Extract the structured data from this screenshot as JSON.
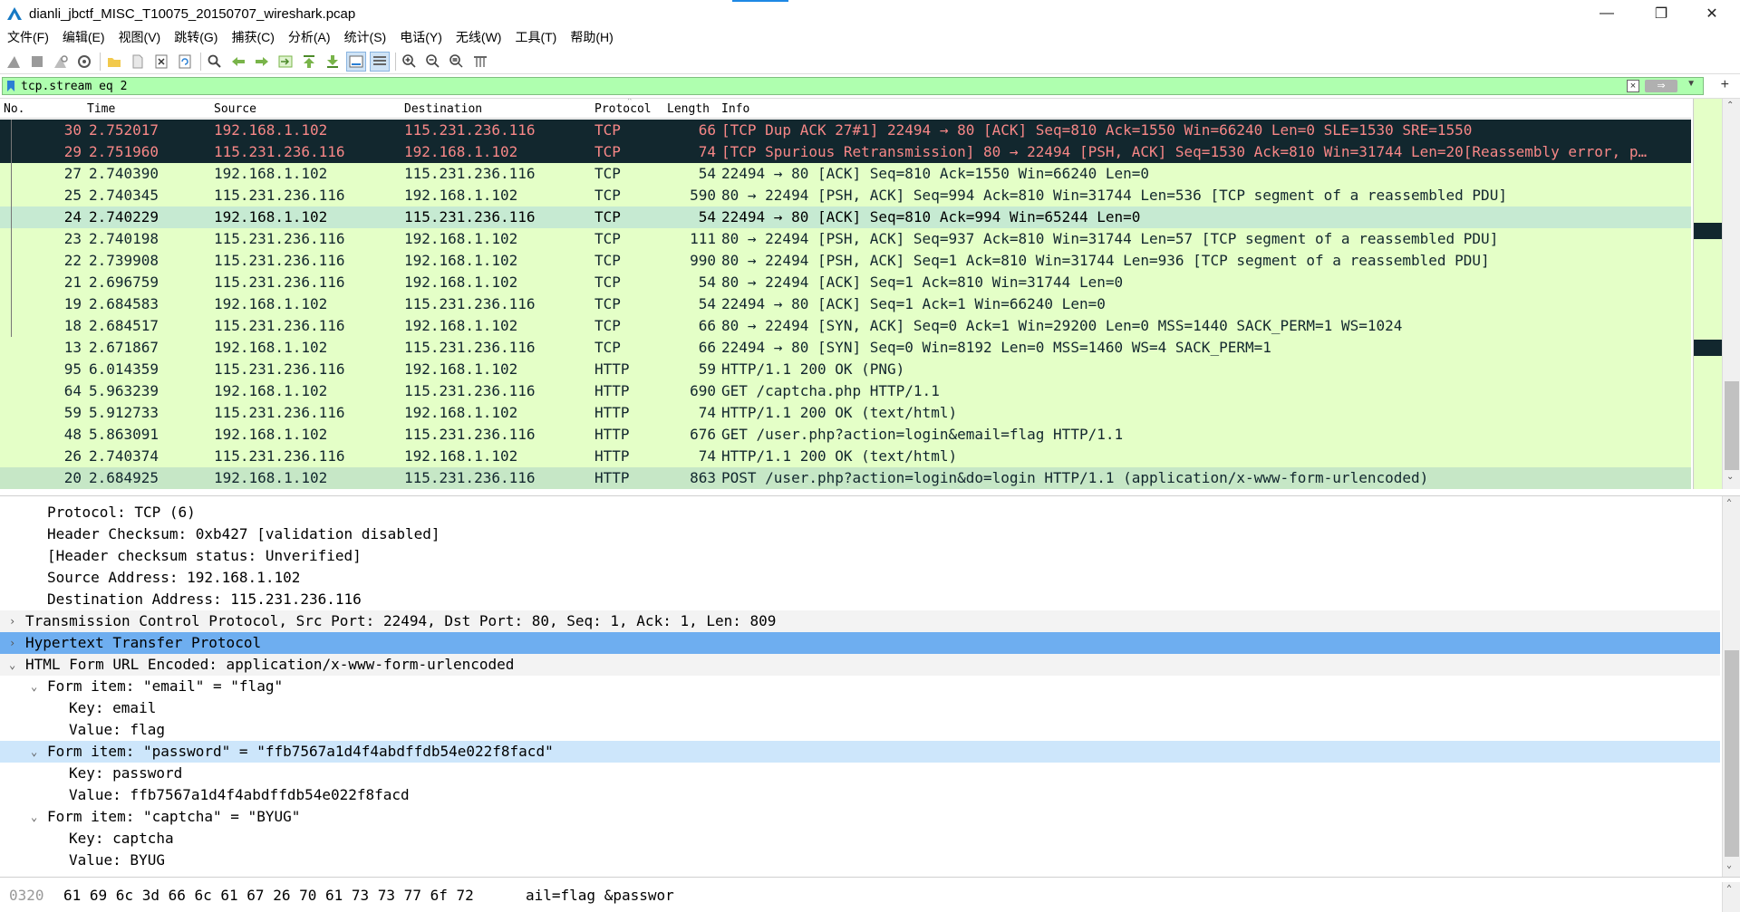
{
  "window": {
    "title": "dianli_jbctf_MISC_T10075_20150707_wireshark.pcap",
    "minimize": "—",
    "maximize": "❐",
    "close": "✕"
  },
  "menu": [
    "文件(F)",
    "编辑(E)",
    "视图(V)",
    "跳转(G)",
    "捕获(C)",
    "分析(A)",
    "统计(S)",
    "电话(Y)",
    "无线(W)",
    "工具(T)",
    "帮助(H)"
  ],
  "filter": {
    "value": "tcp.stream eq 2",
    "clear": "×",
    "apply": "⇒",
    "dropdown": "▼",
    "add": "+"
  },
  "packet_list": {
    "columns": [
      "No.",
      "Time",
      "Source",
      "Destination",
      "Protocol",
      "Length",
      "Info"
    ],
    "rows": [
      {
        "no": "30",
        "time": "2.752017",
        "src": "192.168.1.102",
        "dst": "115.231.236.116",
        "proto": "TCP",
        "len": "66",
        "info": "[TCP Dup ACK 27#1] 22494 → 80 [ACK] Seq=810 Ack=1550 Win=66240 Len=0 SLE=1530 SRE=1550",
        "style": "black"
      },
      {
        "no": "29",
        "time": "2.751960",
        "src": "115.231.236.116",
        "dst": "192.168.1.102",
        "proto": "TCP",
        "len": "74",
        "info": "[TCP Spurious Retransmission] 80 → 22494 [PSH, ACK] Seq=1530 Ack=810 Win=31744 Len=20[Reassembly error, p…",
        "style": "black"
      },
      {
        "no": "27",
        "time": "2.740390",
        "src": "192.168.1.102",
        "dst": "115.231.236.116",
        "proto": "TCP",
        "len": "54",
        "info": "22494 → 80 [ACK] Seq=810 Ack=1550 Win=66240 Len=0",
        "style": "green"
      },
      {
        "no": "25",
        "time": "2.740345",
        "src": "115.231.236.116",
        "dst": "192.168.1.102",
        "proto": "TCP",
        "len": "590",
        "info": "80 → 22494 [PSH, ACK] Seq=994 Ack=810 Win=31744 Len=536 [TCP segment of a reassembled PDU]",
        "style": "green"
      },
      {
        "no": "24",
        "time": "2.740229",
        "src": "192.168.1.102",
        "dst": "115.231.236.116",
        "proto": "TCP",
        "len": "54",
        "info": "22494 → 80 [ACK] Seq=810 Ack=994 Win=65244 Len=0",
        "style": "tint"
      },
      {
        "no": "23",
        "time": "2.740198",
        "src": "115.231.236.116",
        "dst": "192.168.1.102",
        "proto": "TCP",
        "len": "111",
        "info": "80 → 22494 [PSH, ACK] Seq=937 Ack=810 Win=31744 Len=57 [TCP segment of a reassembled PDU]",
        "style": "green"
      },
      {
        "no": "22",
        "time": "2.739908",
        "src": "115.231.236.116",
        "dst": "192.168.1.102",
        "proto": "TCP",
        "len": "990",
        "info": "80 → 22494 [PSH, ACK] Seq=1 Ack=810 Win=31744 Len=936 [TCP segment of a reassembled PDU]",
        "style": "green"
      },
      {
        "no": "21",
        "time": "2.696759",
        "src": "115.231.236.116",
        "dst": "192.168.1.102",
        "proto": "TCP",
        "len": "54",
        "info": "80 → 22494 [ACK] Seq=1 Ack=810 Win=31744 Len=0",
        "style": "green"
      },
      {
        "no": "19",
        "time": "2.684583",
        "src": "192.168.1.102",
        "dst": "115.231.236.116",
        "proto": "TCP",
        "len": "54",
        "info": "22494 → 80 [ACK] Seq=1 Ack=1 Win=66240 Len=0",
        "style": "green"
      },
      {
        "no": "18",
        "time": "2.684517",
        "src": "115.231.236.116",
        "dst": "192.168.1.102",
        "proto": "TCP",
        "len": "66",
        "info": "80 → 22494 [SYN, ACK] Seq=0 Ack=1 Win=29200 Len=0 MSS=1440 SACK_PERM=1 WS=1024",
        "style": "green"
      },
      {
        "no": "13",
        "time": "2.671867",
        "src": "192.168.1.102",
        "dst": "115.231.236.116",
        "proto": "TCP",
        "len": "66",
        "info": "22494 → 80 [SYN] Seq=0 Win=8192 Len=0 MSS=1460 WS=4 SACK_PERM=1",
        "style": "green"
      },
      {
        "no": "95",
        "time": "6.014359",
        "src": "115.231.236.116",
        "dst": "192.168.1.102",
        "proto": "HTTP",
        "len": "59",
        "info": "HTTP/1.1 200 OK  (PNG)",
        "style": "green"
      },
      {
        "no": "64",
        "time": "5.963239",
        "src": "192.168.1.102",
        "dst": "115.231.236.116",
        "proto": "HTTP",
        "len": "690",
        "info": "GET /captcha.php HTTP/1.1",
        "style": "green"
      },
      {
        "no": "59",
        "time": "5.912733",
        "src": "115.231.236.116",
        "dst": "192.168.1.102",
        "proto": "HTTP",
        "len": "74",
        "info": "HTTP/1.1 200 OK  (text/html)",
        "style": "green"
      },
      {
        "no": "48",
        "time": "5.863091",
        "src": "192.168.1.102",
        "dst": "115.231.236.116",
        "proto": "HTTP",
        "len": "676",
        "info": "GET /user.php?action=login&email=flag HTTP/1.1",
        "style": "green"
      },
      {
        "no": "26",
        "time": "2.740374",
        "src": "115.231.236.116",
        "dst": "192.168.1.102",
        "proto": "HTTP",
        "len": "74",
        "info": "HTTP/1.1 200 OK  (text/html)",
        "style": "green"
      },
      {
        "no": "20",
        "time": "2.684925",
        "src": "192.168.1.102",
        "dst": "115.231.236.116",
        "proto": "HTTP",
        "len": "863",
        "info": "POST /user.php?action=login&do=login HTTP/1.1  (application/x-www-form-urlencoded)",
        "style": "selected"
      }
    ]
  },
  "details": {
    "rows": [
      {
        "indent": 1,
        "arrow": "",
        "text": "Protocol: TCP (6)",
        "style": ""
      },
      {
        "indent": 1,
        "arrow": "",
        "text": "Header Checksum: 0xb427 [validation disabled]",
        "style": ""
      },
      {
        "indent": 1,
        "arrow": "",
        "text": "[Header checksum status: Unverified]",
        "style": ""
      },
      {
        "indent": 1,
        "arrow": "",
        "text": "Source Address: 192.168.1.102",
        "style": ""
      },
      {
        "indent": 1,
        "arrow": "",
        "text": "Destination Address: 115.231.236.116",
        "style": ""
      },
      {
        "indent": 0,
        "arrow": "›",
        "text": "Transmission Control Protocol, Src Port: 22494, Dst Port: 80, Seq: 1, Ack: 1, Len: 809",
        "style": "gray"
      },
      {
        "indent": 0,
        "arrow": "›",
        "text": "Hypertext Transfer Protocol",
        "style": "blue"
      },
      {
        "indent": 0,
        "arrow": "⌄",
        "text": "HTML Form URL Encoded: application/x-www-form-urlencoded",
        "style": "gray"
      },
      {
        "indent": 1,
        "arrow": "⌄",
        "text": "Form item: \"email\" = \"flag\"",
        "style": ""
      },
      {
        "indent": 2,
        "arrow": "",
        "text": "Key: email",
        "style": ""
      },
      {
        "indent": 2,
        "arrow": "",
        "text": "Value: flag",
        "style": ""
      },
      {
        "indent": 1,
        "arrow": "⌄",
        "text": "Form item: \"password\" = \"ffb7567a1d4f4abdffdb54e022f8facd\"",
        "style": "light"
      },
      {
        "indent": 2,
        "arrow": "",
        "text": "Key: password",
        "style": ""
      },
      {
        "indent": 2,
        "arrow": "",
        "text": "Value: ffb7567a1d4f4abdffdb54e022f8facd",
        "style": ""
      },
      {
        "indent": 1,
        "arrow": "⌄",
        "text": "Form item: \"captcha\" = \"BYUG\"",
        "style": ""
      },
      {
        "indent": 2,
        "arrow": "",
        "text": "Key: captcha",
        "style": ""
      },
      {
        "indent": 2,
        "arrow": "",
        "text": "Value: BYUG",
        "style": ""
      }
    ]
  },
  "bytes": {
    "offset": "0320",
    "hex": "61 69 6c 3d 66 6c 61 67  26 70 61 73 73 77 6f 72",
    "ascii": "ail=flag &passwor"
  },
  "colors": {
    "filter_valid": "#afffaf",
    "tcp_row": "#e4ffc7",
    "bad_row_bg": "#12272e",
    "bad_row_fg": "#f78787",
    "selected_tree": "#6eaef0"
  }
}
